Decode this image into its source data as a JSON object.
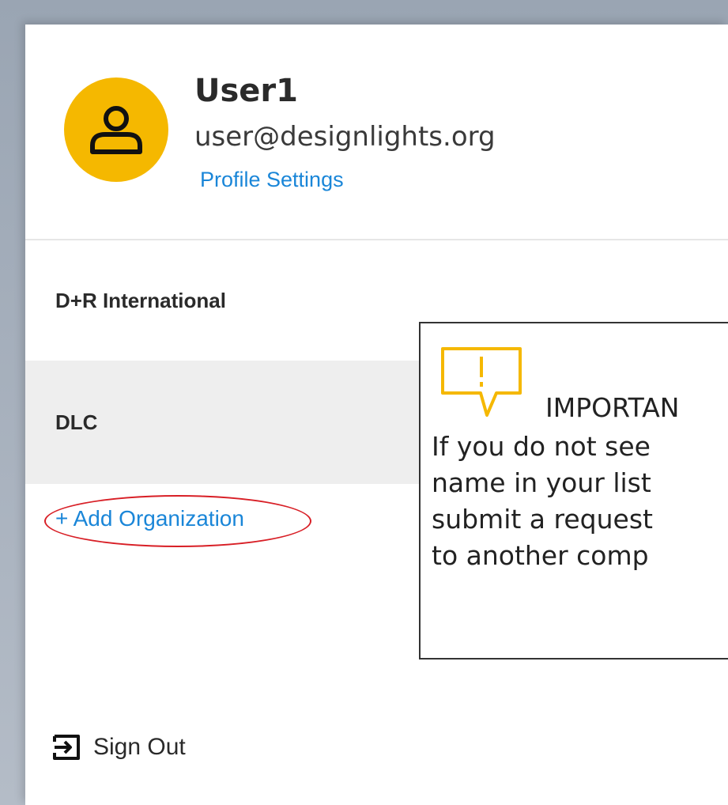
{
  "user": {
    "name": "User1",
    "email": "user@designlights.org",
    "profile_link": "Profile Settings"
  },
  "organizations": [
    {
      "name": "D+R International"
    },
    {
      "name": "DLC"
    }
  ],
  "add_org_label": "+ Add Organization",
  "callout": {
    "title": "IMPORTAN",
    "lines": [
      "If you do not see",
      "name in your list",
      "submit a request",
      "to another comp"
    ]
  },
  "sign_out_label": "Sign Out",
  "colors": {
    "accent": "#1a86d8",
    "avatar": "#f5b800",
    "highlight_ring": "#d81f26",
    "selected_row": "#eeeeee"
  },
  "icons": {
    "avatar": "user-icon",
    "callout": "warning-speech-bubble-icon",
    "sign_out": "sign-out-icon"
  }
}
